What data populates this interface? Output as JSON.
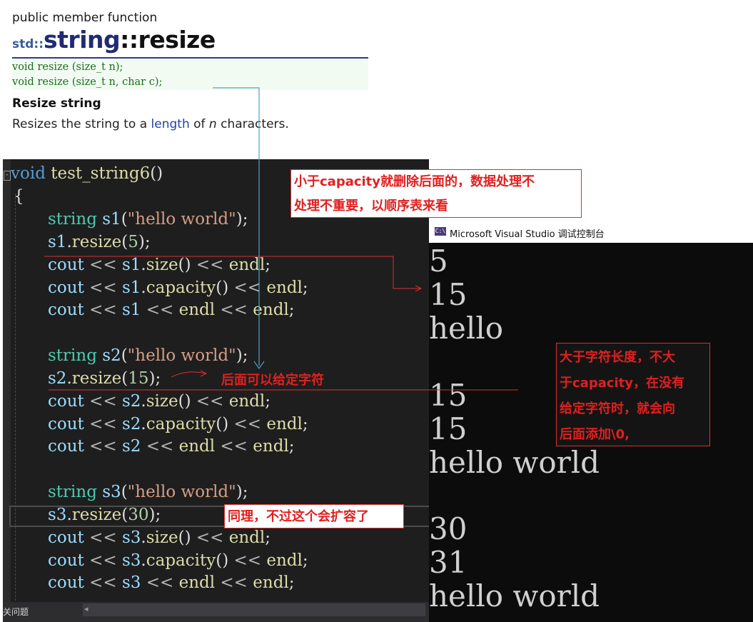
{
  "doc": {
    "kind": "public member function",
    "title_ns": "std::",
    "title_class": "string",
    "title_sep": "::",
    "title_method": "resize",
    "prototypes": [
      "void resize (size_t n);",
      "void resize (size_t n, char c);"
    ],
    "section_heading": "Resize string",
    "description": {
      "before": "Resizes the string to a ",
      "link": "length",
      "middle": " of ",
      "param": "n",
      "after": " characters."
    }
  },
  "editor": {
    "fold_glyph": "-",
    "lines": {
      "sig_kw": "void",
      "sig_fn": "test_string6",
      "sig_paren": "()",
      "brace": "{",
      "ty": "string",
      "s1": "s1",
      "s2": "s2",
      "s3": "s3",
      "lit": "\"hello world\"",
      "open": "(",
      "close_semi": ");",
      "dot": ".",
      "resize": "resize",
      "n5": "5",
      "n15": "15",
      "n30": "30",
      "cout": "cout",
      "shl": "<<",
      "size_call": "size",
      "cap_call": "capacity",
      "empty_call": "()",
      "endl": "endl",
      "semi": ";"
    },
    "status_text": "关问题",
    "scroll_arrow": "◂"
  },
  "console": {
    "title": "Microsoft Visual Studio 调试控制台",
    "icon_label": "C:\\",
    "output": [
      "5",
      "15",
      "hello",
      "15",
      "15",
      "hello world",
      "30",
      "31",
      "hello world"
    ]
  },
  "annotations": {
    "note1": [
      "小于capacity就删除后面的，数据处理不",
      "处理不重要，以顺序表来看"
    ],
    "note2": [
      "大于字符长度，不大",
      "于capacity，在没有",
      "给定字符时，就会向",
      "后面添加\\0,"
    ],
    "note3": "同理，不过这个会扩容了",
    "inline": "后面可以给定字符"
  },
  "colors": {
    "annotation": "#e02020",
    "editor_bg": "#1e1e1e",
    "console_bg": "#0c0c0c"
  }
}
